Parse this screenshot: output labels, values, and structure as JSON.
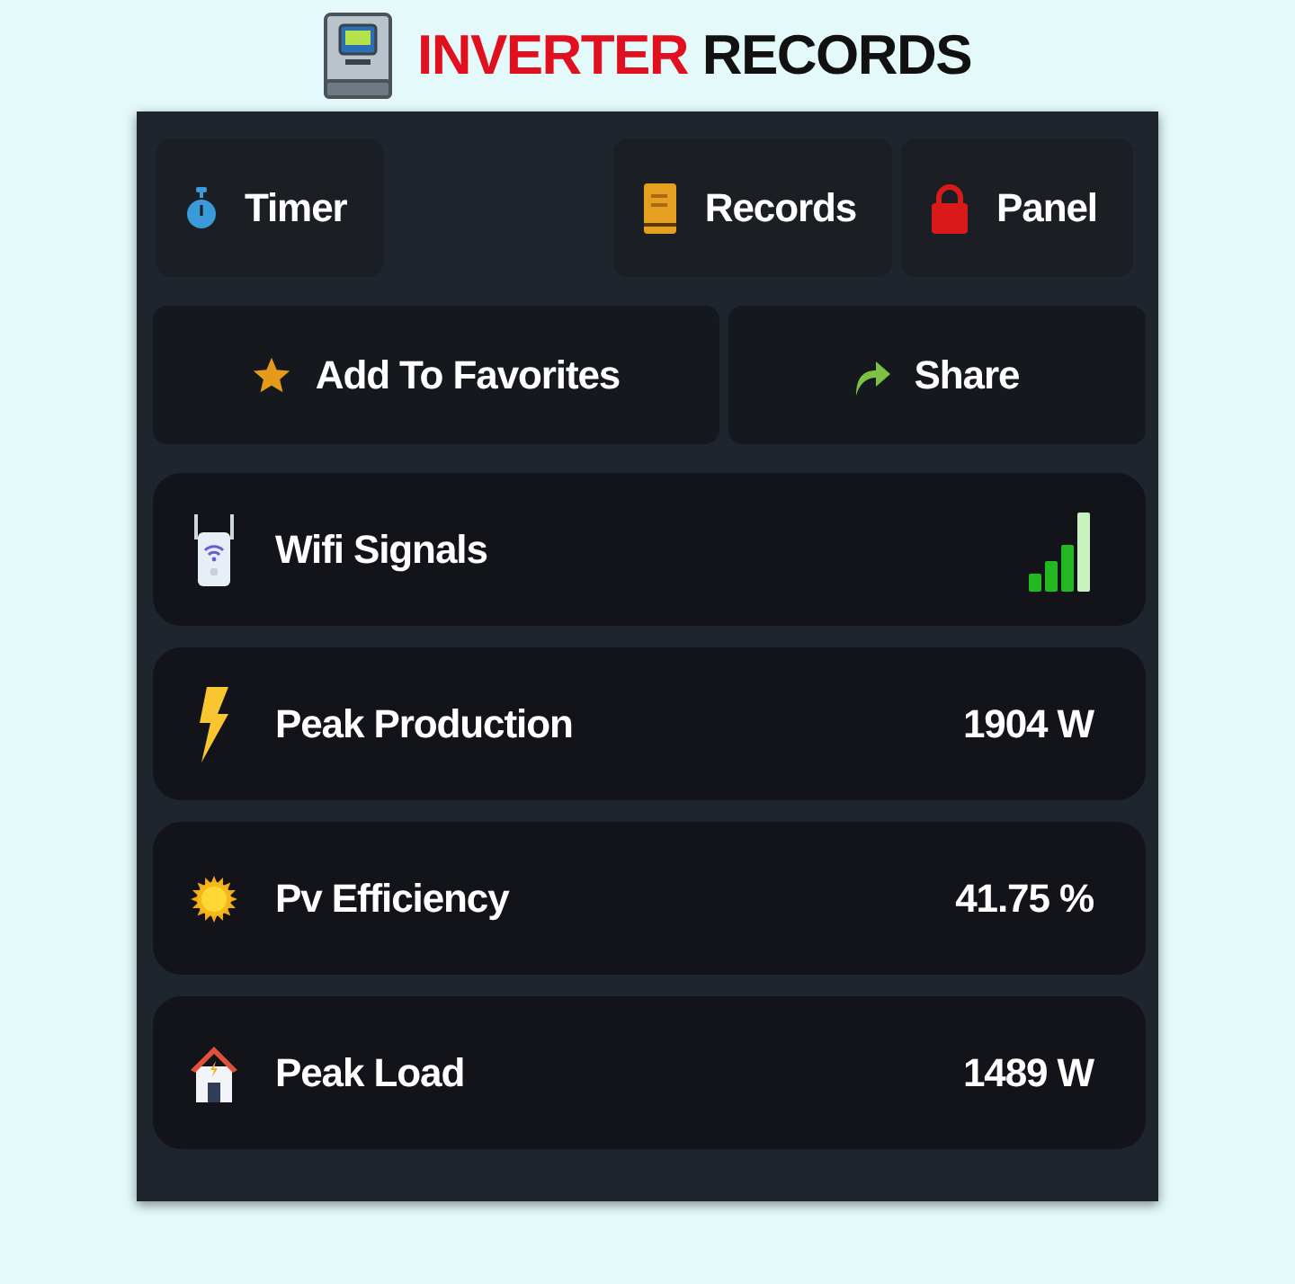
{
  "header": {
    "title_accent": "INVERTER",
    "title_rest": "RECORDS"
  },
  "toolbar": {
    "left": [
      {
        "label": "Timer"
      }
    ],
    "right": [
      {
        "label": "Records"
      },
      {
        "label": "Panel"
      }
    ]
  },
  "actions": [
    {
      "label": "Add To Favorites"
    },
    {
      "label": "Share"
    }
  ],
  "stats": [
    {
      "kind": "signal",
      "label": "Wifi Signals"
    },
    {
      "kind": "reading",
      "label": "Peak Production",
      "value": "1904 W"
    },
    {
      "kind": "reading",
      "label": "Pv Efficiency",
      "value": "41.75 %"
    },
    {
      "kind": "reading",
      "label": "Peak Load",
      "value": "1489 W"
    }
  ]
}
